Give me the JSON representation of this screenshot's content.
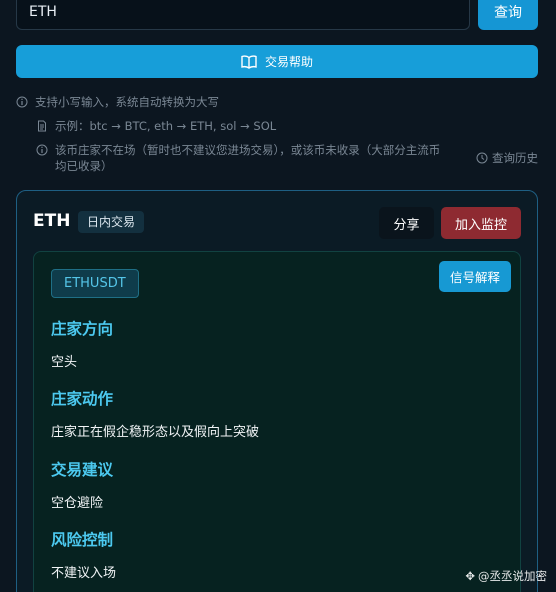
{
  "search": {
    "value": "ETH",
    "button_label": "查询"
  },
  "help_button": {
    "label": "交易帮助",
    "icon": "book-open-icon"
  },
  "tips": {
    "line1": "支持小写输入，系统自动转换为大写",
    "line2": "示例：btc → BTC, eth → ETH, sol → SOL",
    "line3": "该币庄家不在场（暂时也不建议您进场交易），或该币未收录（大部分主流币均已收录）",
    "history_label": "查询历史"
  },
  "card": {
    "title": "ETH",
    "badge": "日内交易",
    "share_label": "分享",
    "monitor_label": "加入监控",
    "pair": "ETHUSDT",
    "explain_label": "信号解释",
    "sections": [
      {
        "heading": "庄家方向",
        "value": "空头"
      },
      {
        "heading": "庄家动作",
        "value": "庄家正在假企稳形态以及假向上突破"
      },
      {
        "heading": "交易建议",
        "value": "空仓避险"
      },
      {
        "heading": "风险控制",
        "value": "不建议入场"
      }
    ]
  },
  "watermark": "@丞丞说加密",
  "colors": {
    "background": "#0c1620",
    "accent": "#179ed9",
    "danger": "#8e2a31",
    "heading": "#4cc9ef"
  }
}
